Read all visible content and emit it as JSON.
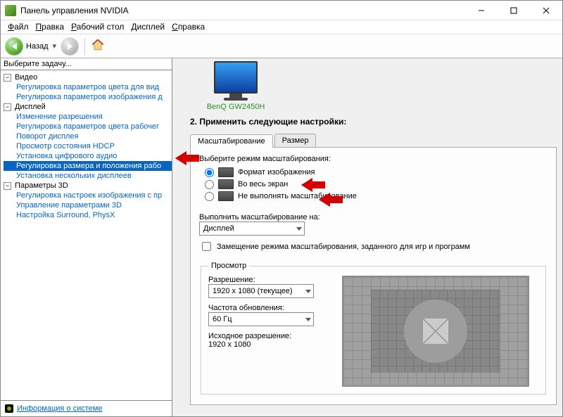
{
  "window": {
    "title": "Панель управления NVIDIA"
  },
  "menu": [
    "Файл",
    "Правка",
    "Рабочий стол",
    "Дисплей",
    "Справка"
  ],
  "toolbar": {
    "back_label": "Назад"
  },
  "sidebar": {
    "header": "Выберите задачу...",
    "groups": [
      {
        "label": "Видео",
        "items": [
          "Регулировка параметров цвета для вид",
          "Регулировка параметров изображения д"
        ]
      },
      {
        "label": "Дисплей",
        "items": [
          "Изменение разрешения",
          "Регулировка параметров цвета рабочег",
          "Поворот дисплея",
          "Просмотр состояния HDCP",
          "Установка цифрового аудио",
          "Регулировка размера и положения рабо",
          "Установка нескольких дисплеев"
        ],
        "selected_index": 5
      },
      {
        "label": "Параметры 3D",
        "items": [
          "Регулировка настроек изображения с пр",
          "Управление параметрами 3D",
          "Настройка Surround, PhysX"
        ]
      }
    ],
    "footer_link": "Информация о системе"
  },
  "content": {
    "monitor_label": "BenQ GW2450H",
    "section_title": "2. Применить следующие настройки:",
    "tabs": [
      "Масштабирование",
      "Размер"
    ],
    "active_tab": 0,
    "scaling_mode_label": "Выберите режим масштабирования:",
    "scaling_options": [
      "Формат изображения",
      "Во весь экран",
      "Не выполнять масштабирование"
    ],
    "scaling_selected": 0,
    "perform_on_label": "Выполнить масштабирование на:",
    "perform_on_value": "Дисплей",
    "override_label": "Замещение режима масштабирования, заданного для игр и программ",
    "override_checked": false,
    "preview_legend": "Просмотр",
    "resolution_label": "Разрешение:",
    "resolution_value": "1920 x 1080 (текущее)",
    "refresh_label": "Частота обновления:",
    "refresh_value": "60 Гц",
    "native_label": "Исходное разрешение:",
    "native_value": "1920 x 1080"
  }
}
